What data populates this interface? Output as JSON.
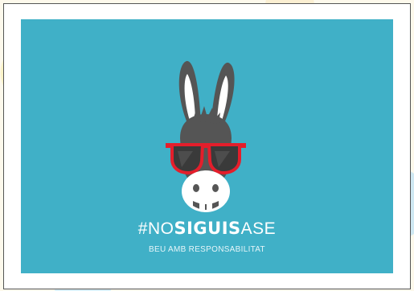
{
  "poster": {
    "hashtag_prefix": "#NO",
    "hashtag_bold": "SIGUIS",
    "hashtag_suffix": "ASE",
    "tagline": "BEU AMB RESPONSABILITAT"
  },
  "colors": {
    "background": "#40b0c7",
    "donkey": "#555555",
    "glasses": "#e41e2b",
    "text": "#ffffff"
  },
  "icons": [
    "donkey-illustration",
    "red-sunglasses"
  ]
}
